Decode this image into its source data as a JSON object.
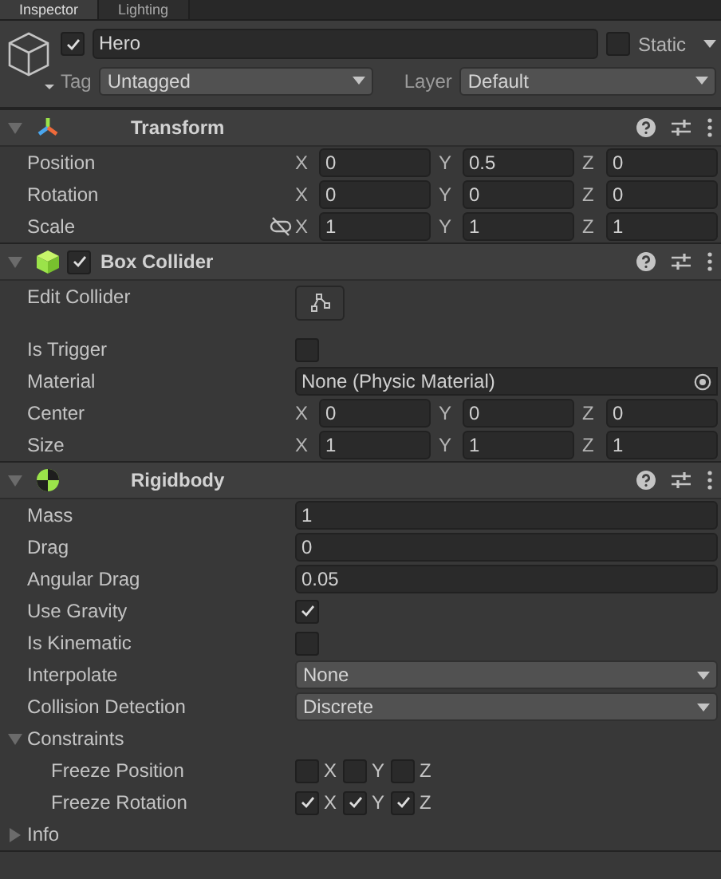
{
  "tabs": [
    {
      "label": "Inspector",
      "selected": true
    },
    {
      "label": "Lighting",
      "selected": false
    }
  ],
  "object": {
    "active": true,
    "name": "Hero",
    "static": false,
    "static_label": "Static",
    "tag_label": "Tag",
    "tag": "Untagged",
    "layer_label": "Layer",
    "layer": "Default"
  },
  "components": [
    {
      "kind": "transform",
      "title": "Transform",
      "expanded": true,
      "rows": [
        {
          "kind": "vector",
          "label": "Position",
          "values": [
            {
              "axis": "X",
              "value": "0"
            },
            {
              "axis": "Y",
              "value": "0.5"
            },
            {
              "axis": "Z",
              "value": "0"
            }
          ]
        },
        {
          "kind": "vector",
          "label": "Rotation",
          "values": [
            {
              "axis": "X",
              "value": "0"
            },
            {
              "axis": "Y",
              "value": "0"
            },
            {
              "axis": "Z",
              "value": "0"
            }
          ]
        },
        {
          "kind": "vector",
          "label": "Scale",
          "linked": false,
          "values": [
            {
              "axis": "X",
              "value": "1"
            },
            {
              "axis": "Y",
              "value": "1"
            },
            {
              "axis": "Z",
              "value": "1"
            }
          ]
        }
      ]
    },
    {
      "kind": "collider",
      "title": "Box Collider",
      "enabled": true,
      "expanded": true,
      "rows": [
        {
          "kind": "button",
          "label": "Edit Collider"
        },
        {
          "kind": "checkbox",
          "label": "Is Trigger",
          "checked": false
        },
        {
          "kind": "object",
          "label": "Material",
          "value": "None (Physic Material)"
        },
        {
          "kind": "vector",
          "label": "Center",
          "values": [
            {
              "axis": "X",
              "value": "0"
            },
            {
              "axis": "Y",
              "value": "0"
            },
            {
              "axis": "Z",
              "value": "0"
            }
          ]
        },
        {
          "kind": "vector",
          "label": "Size",
          "values": [
            {
              "axis": "X",
              "value": "1"
            },
            {
              "axis": "Y",
              "value": "1"
            },
            {
              "axis": "Z",
              "value": "1"
            }
          ]
        }
      ]
    },
    {
      "kind": "rigidbody",
      "title": "Rigidbody",
      "expanded": true,
      "rows": [
        {
          "kind": "number",
          "label": "Mass",
          "value": "1"
        },
        {
          "kind": "number",
          "label": "Drag",
          "value": "0"
        },
        {
          "kind": "number",
          "label": "Angular Drag",
          "value": "0.05"
        },
        {
          "kind": "checkbox",
          "label": "Use Gravity",
          "checked": true
        },
        {
          "kind": "checkbox",
          "label": "Is Kinematic",
          "checked": false
        },
        {
          "kind": "dropdown",
          "label": "Interpolate",
          "value": "None"
        },
        {
          "kind": "dropdown",
          "label": "Collision Detection",
          "value": "Discrete"
        },
        {
          "kind": "foldout",
          "label": "Constraints",
          "expanded": true,
          "children": [
            {
              "kind": "axes",
              "label": "Freeze Position",
              "axes": [
                {
                  "axis": "X",
                  "checked": false
                },
                {
                  "axis": "Y",
                  "checked": false
                },
                {
                  "axis": "Z",
                  "checked": false
                }
              ]
            },
            {
              "kind": "axes",
              "label": "Freeze Rotation",
              "axes": [
                {
                  "axis": "X",
                  "checked": true
                },
                {
                  "axis": "Y",
                  "checked": true
                },
                {
                  "axis": "Z",
                  "checked": true
                }
              ]
            }
          ]
        },
        {
          "kind": "foldout",
          "label": "Info",
          "expanded": false
        }
      ]
    }
  ]
}
